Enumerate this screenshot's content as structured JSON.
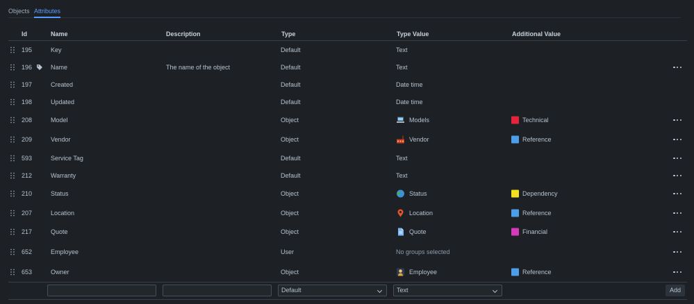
{
  "tabs": [
    {
      "label": "Objects",
      "active": false
    },
    {
      "label": "Attributes",
      "active": true
    }
  ],
  "columns": {
    "id": "Id",
    "name": "Name",
    "description": "Description",
    "type": "Type",
    "type_value": "Type Value",
    "additional_value": "Additional Value"
  },
  "rows": [
    {
      "id": "195",
      "name": "Key",
      "description": "",
      "type": "Default",
      "type_value": "Text",
      "label_icon": false,
      "more": false
    },
    {
      "id": "196",
      "name": "Name",
      "description": "The name of the object",
      "type": "Default",
      "type_value": "Text",
      "label_icon": true,
      "more": true
    },
    {
      "id": "197",
      "name": "Created",
      "description": "",
      "type": "Default",
      "type_value": "Date time",
      "more": false
    },
    {
      "id": "198",
      "name": "Updated",
      "description": "",
      "type": "Default",
      "type_value": "Date time",
      "more": false
    },
    {
      "id": "208",
      "name": "Model",
      "description": "",
      "type": "Object",
      "type_value": "Models",
      "type_value_icon": "laptop-icon",
      "additional_value": "Technical",
      "additional_color": "#e5243b",
      "more": true
    },
    {
      "id": "209",
      "name": "Vendor",
      "description": "",
      "type": "Object",
      "type_value": "Vendor",
      "type_value_icon": "factory-icon",
      "additional_value": "Reference",
      "additional_color": "#4c9ee8",
      "more": true
    },
    {
      "id": "593",
      "name": "Service Tag",
      "description": "",
      "type": "Default",
      "type_value": "Text",
      "more": true
    },
    {
      "id": "212",
      "name": "Warranty",
      "description": "",
      "type": "Default",
      "type_value": "Text",
      "more": true
    },
    {
      "id": "210",
      "name": "Status",
      "description": "",
      "type": "Object",
      "type_value": "Status",
      "type_value_icon": "globe-icon",
      "additional_value": "Dependency",
      "additional_color": "#f2e21d",
      "more": true
    },
    {
      "id": "207",
      "name": "Location",
      "description": "",
      "type": "Object",
      "type_value": "Location",
      "type_value_icon": "map-pin-icon",
      "additional_value": "Reference",
      "additional_color": "#4c9ee8",
      "more": true
    },
    {
      "id": "217",
      "name": "Quote",
      "description": "",
      "type": "Object",
      "type_value": "Quote",
      "type_value_icon": "document-icon",
      "additional_value": "Financial",
      "additional_color": "#d63ab8",
      "more": true
    },
    {
      "id": "652",
      "name": "Employee",
      "description": "",
      "type": "User",
      "type_value": "No groups selected",
      "type_value_muted": true,
      "more": true
    },
    {
      "id": "653",
      "name": "Owner",
      "description": "",
      "type": "Object",
      "type_value": "Employee",
      "type_value_icon": "person-icon",
      "additional_value": "Reference",
      "additional_color": "#4c9ee8",
      "more": true
    }
  ],
  "new_row": {
    "name_value": "",
    "description_value": "",
    "type_select": "Default",
    "type_value_select": "Text",
    "add_label": "Add"
  }
}
